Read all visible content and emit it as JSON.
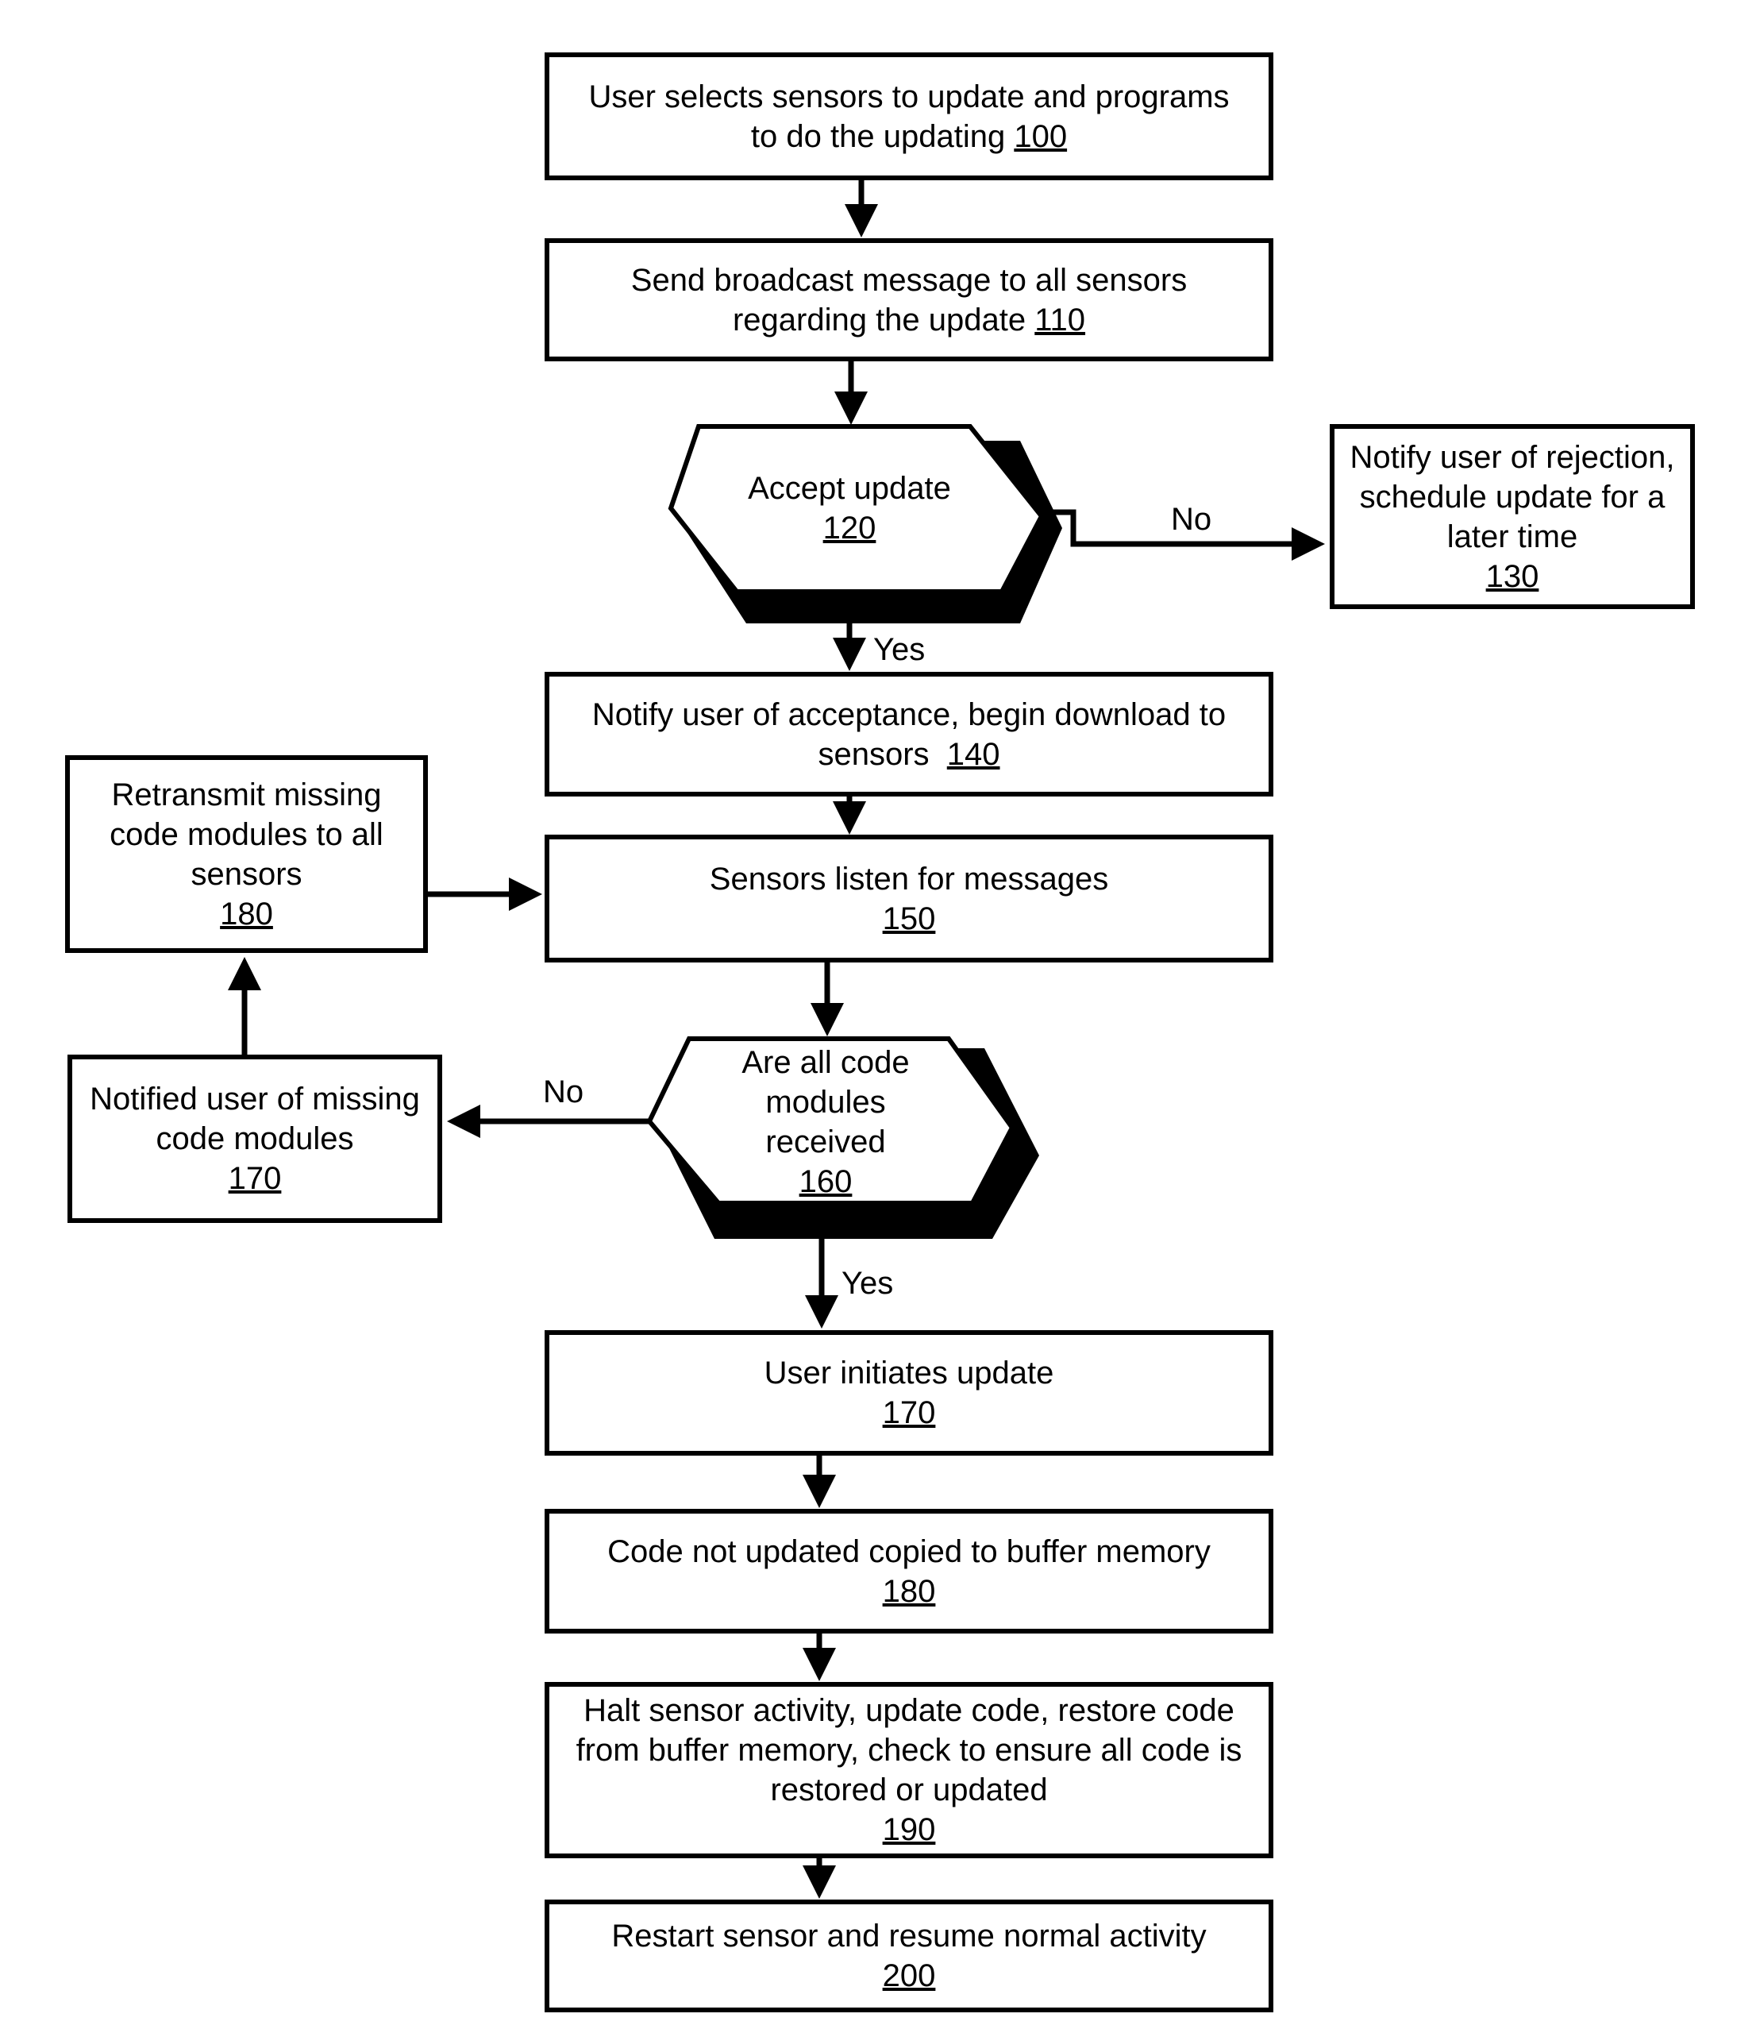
{
  "steps": {
    "s100": {
      "text": "User selects sensors to update and programs to do the updating",
      "ref": "100"
    },
    "s110": {
      "text": "Send broadcast message to all sensors regarding the update",
      "ref": "110"
    },
    "s120": {
      "text": "Accept update",
      "ref": "120"
    },
    "s130": {
      "text": "Notify user of rejection, schedule update for a later time",
      "ref": "130"
    },
    "s140": {
      "text": "Notify user of acceptance, begin download to sensors",
      "ref": "140"
    },
    "s150": {
      "text": "Sensors listen for messages",
      "ref": "150"
    },
    "s160": {
      "text": "Are all code modules received",
      "ref": "160"
    },
    "s170_left": {
      "text": "Notified user of missing code modules",
      "ref": "170"
    },
    "s180_left": {
      "text": "Retransmit missing code modules to all sensors",
      "ref": "180"
    },
    "s170": {
      "text": "User initiates update",
      "ref": "170"
    },
    "s180": {
      "text": "Code not updated copied to buffer memory",
      "ref": "180"
    },
    "s190": {
      "text": "Halt sensor activity, update code, restore code from buffer memory, check to ensure all code is restored or updated",
      "ref": "190"
    },
    "s200": {
      "text": "Restart sensor and resume normal activity",
      "ref": "200"
    }
  },
  "labels": {
    "no_120": "No",
    "yes_120": "Yes",
    "no_160": "No",
    "yes_160": "Yes"
  }
}
